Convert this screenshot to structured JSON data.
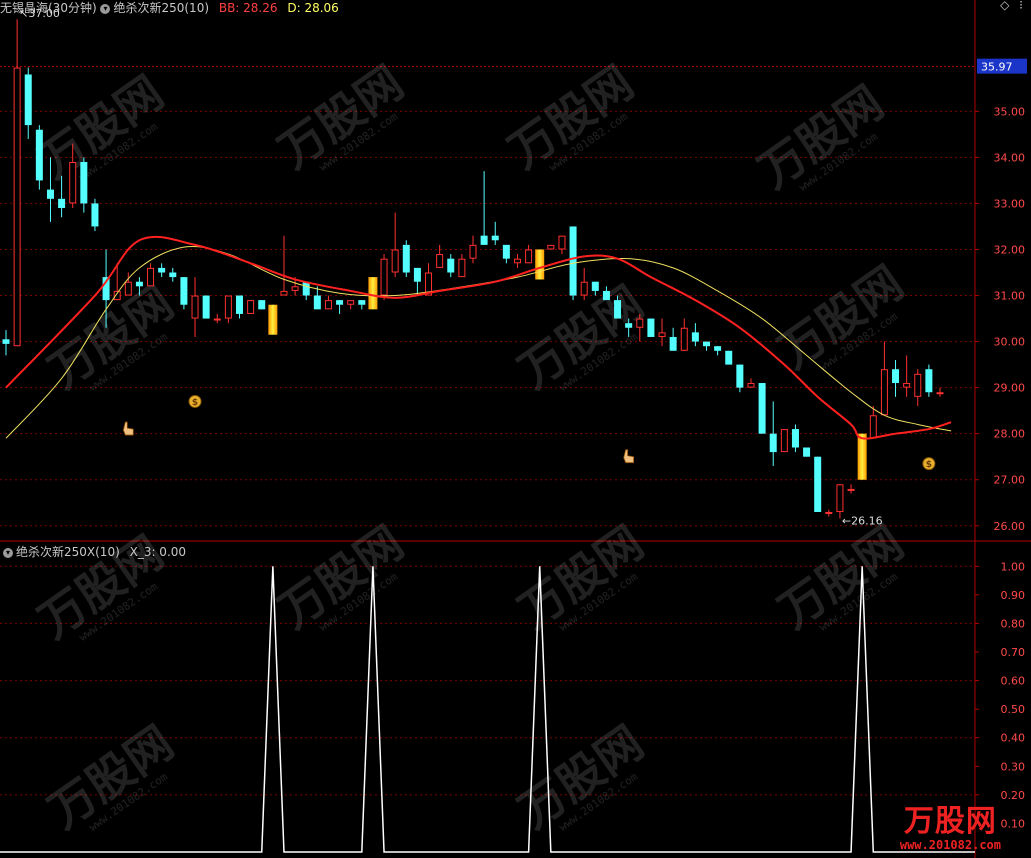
{
  "header": {
    "stock": "无锡晶海(30分钟)",
    "indicator": "绝杀次新250(10)",
    "bb_label": "BB: 28.26",
    "d_label": "D: 28.06"
  },
  "sub_header": {
    "indicator": "绝杀次新250X(10)",
    "value_label": "X_3: 0.00"
  },
  "top_right_icons": [
    "diamond-icon",
    "more-icon"
  ],
  "watermark": {
    "text": "万股网",
    "url": "www.201082.com"
  },
  "logo": {
    "text": "万股网",
    "url": "www.201082.com"
  },
  "colors": {
    "up": "#ff3030",
    "down": "#54ffff",
    "signal": "#ffcc00",
    "line_red": "#ff2020",
    "line_yellow": "#f0e060",
    "grid": "#7a0000"
  },
  "chart_data": [
    {
      "type": "candlestick",
      "ylim": [
        25.8,
        37.2
      ],
      "y_ticks": [
        26.0,
        27.0,
        28.0,
        29.0,
        30.0,
        31.0,
        32.0,
        33.0,
        34.0,
        35.0
      ],
      "current_price_label": "35.97",
      "max_label": "37.00",
      "min_label": "26.16",
      "candles": [
        {
          "o": 30.05,
          "h": 30.25,
          "l": 29.7,
          "c": 29.95
        },
        {
          "o": 29.9,
          "h": 37.0,
          "l": 29.9,
          "c": 35.95
        },
        {
          "o": 35.8,
          "h": 35.95,
          "l": 34.4,
          "c": 34.7
        },
        {
          "o": 34.6,
          "h": 34.7,
          "l": 33.3,
          "c": 33.5
        },
        {
          "o": 33.3,
          "h": 34.0,
          "l": 32.6,
          "c": 33.1
        },
        {
          "o": 33.1,
          "h": 33.6,
          "l": 32.7,
          "c": 32.9
        },
        {
          "o": 33.0,
          "h": 34.3,
          "l": 32.9,
          "c": 33.9
        },
        {
          "o": 33.9,
          "h": 34.0,
          "l": 32.8,
          "c": 33.0
        },
        {
          "o": 33.0,
          "h": 33.1,
          "l": 32.4,
          "c": 32.5
        },
        {
          "o": 31.4,
          "h": 32.0,
          "l": 30.3,
          "c": 30.9
        },
        {
          "o": 30.9,
          "h": 31.7,
          "l": 30.9,
          "c": 31.1
        },
        {
          "o": 31.0,
          "h": 31.5,
          "l": 31.0,
          "c": 31.3
        },
        {
          "o": 31.3,
          "h": 31.4,
          "l": 31.0,
          "c": 31.2
        },
        {
          "o": 31.2,
          "h": 31.7,
          "l": 31.2,
          "c": 31.6
        },
        {
          "o": 31.6,
          "h": 31.7,
          "l": 31.4,
          "c": 31.5
        },
        {
          "o": 31.5,
          "h": 31.6,
          "l": 31.3,
          "c": 31.4
        },
        {
          "o": 31.4,
          "h": 31.4,
          "l": 30.7,
          "c": 30.8
        },
        {
          "o": 30.5,
          "h": 31.4,
          "l": 30.1,
          "c": 31.0
        },
        {
          "o": 31.0,
          "h": 31.0,
          "l": 30.5,
          "c": 30.5
        },
        {
          "o": 30.5,
          "h": 30.6,
          "l": 30.4,
          "c": 30.5
        },
        {
          "o": 30.5,
          "h": 31.0,
          "l": 30.4,
          "c": 31.0
        },
        {
          "o": 31.0,
          "h": 31.0,
          "l": 30.5,
          "c": 30.6
        },
        {
          "o": 30.6,
          "h": 30.9,
          "l": 30.6,
          "c": 30.9
        },
        {
          "o": 30.9,
          "h": 30.9,
          "l": 30.7,
          "c": 30.7
        },
        {
          "o": 30.7,
          "h": 30.8,
          "l": 30.6,
          "c": 30.8
        },
        {
          "o": 31.0,
          "h": 32.3,
          "l": 31.0,
          "c": 31.1
        },
        {
          "o": 31.1,
          "h": 31.4,
          "l": 31.0,
          "c": 31.2
        },
        {
          "o": 31.3,
          "h": 31.3,
          "l": 30.9,
          "c": 31.0
        },
        {
          "o": 31.0,
          "h": 31.2,
          "l": 30.8,
          "c": 30.7
        },
        {
          "o": 30.7,
          "h": 31.0,
          "l": 30.7,
          "c": 30.9
        },
        {
          "o": 30.9,
          "h": 30.9,
          "l": 30.6,
          "c": 30.8
        },
        {
          "o": 30.8,
          "h": 30.9,
          "l": 30.7,
          "c": 30.9
        },
        {
          "o": 30.9,
          "h": 30.9,
          "l": 30.7,
          "c": 30.8
        },
        {
          "o": 30.7,
          "h": 31.4,
          "l": 30.7,
          "c": 31.4
        },
        {
          "o": 31.0,
          "h": 31.9,
          "l": 30.9,
          "c": 31.8
        },
        {
          "o": 31.5,
          "h": 32.8,
          "l": 31.4,
          "c": 32.0
        },
        {
          "o": 32.1,
          "h": 32.2,
          "l": 31.4,
          "c": 31.5
        },
        {
          "o": 31.6,
          "h": 31.6,
          "l": 31.0,
          "c": 31.3
        },
        {
          "o": 31.0,
          "h": 31.7,
          "l": 31.0,
          "c": 31.5
        },
        {
          "o": 31.6,
          "h": 32.1,
          "l": 31.6,
          "c": 31.9
        },
        {
          "o": 31.8,
          "h": 31.9,
          "l": 31.4,
          "c": 31.5
        },
        {
          "o": 31.4,
          "h": 31.9,
          "l": 31.4,
          "c": 31.8
        },
        {
          "o": 31.8,
          "h": 32.3,
          "l": 31.7,
          "c": 32.1
        },
        {
          "o": 32.3,
          "h": 33.7,
          "l": 32.1,
          "c": 32.1
        },
        {
          "o": 32.3,
          "h": 32.6,
          "l": 32.1,
          "c": 32.2
        },
        {
          "o": 32.1,
          "h": 32.1,
          "l": 31.7,
          "c": 31.8
        },
        {
          "o": 31.7,
          "h": 31.9,
          "l": 31.6,
          "c": 31.8
        },
        {
          "o": 31.7,
          "h": 32.1,
          "l": 31.7,
          "c": 32.0
        },
        {
          "o": 31.9,
          "h": 32.0,
          "l": 31.8,
          "c": 32.0
        },
        {
          "o": 32.0,
          "h": 32.1,
          "l": 32.0,
          "c": 32.1
        },
        {
          "o": 32.0,
          "h": 32.3,
          "l": 31.9,
          "c": 32.3
        },
        {
          "o": 32.5,
          "h": 32.5,
          "l": 30.9,
          "c": 31.0
        },
        {
          "o": 31.0,
          "h": 31.6,
          "l": 30.9,
          "c": 31.3
        },
        {
          "o": 31.3,
          "h": 31.3,
          "l": 31.0,
          "c": 31.1
        },
        {
          "o": 31.1,
          "h": 31.2,
          "l": 30.9,
          "c": 30.9
        },
        {
          "o": 30.9,
          "h": 31.0,
          "l": 30.5,
          "c": 30.5
        },
        {
          "o": 30.4,
          "h": 30.5,
          "l": 30.1,
          "c": 30.3
        },
        {
          "o": 30.3,
          "h": 30.6,
          "l": 30.0,
          "c": 30.5
        },
        {
          "o": 30.5,
          "h": 30.5,
          "l": 30.1,
          "c": 30.1
        },
        {
          "o": 30.1,
          "h": 30.5,
          "l": 29.9,
          "c": 30.2
        },
        {
          "o": 30.1,
          "h": 30.3,
          "l": 29.8,
          "c": 29.8
        },
        {
          "o": 29.8,
          "h": 30.5,
          "l": 29.8,
          "c": 30.3
        },
        {
          "o": 30.2,
          "h": 30.4,
          "l": 29.9,
          "c": 30.0
        },
        {
          "o": 30.0,
          "h": 30.0,
          "l": 29.8,
          "c": 29.9
        },
        {
          "o": 29.9,
          "h": 29.9,
          "l": 29.7,
          "c": 29.8
        },
        {
          "o": 29.8,
          "h": 29.8,
          "l": 29.5,
          "c": 29.5
        },
        {
          "o": 29.5,
          "h": 29.5,
          "l": 28.9,
          "c": 29.0
        },
        {
          "o": 29.0,
          "h": 29.2,
          "l": 29.0,
          "c": 29.1
        },
        {
          "o": 29.1,
          "h": 29.1,
          "l": 28.0,
          "c": 28.0
        },
        {
          "o": 28.0,
          "h": 28.7,
          "l": 27.3,
          "c": 27.6
        },
        {
          "o": 27.6,
          "h": 28.1,
          "l": 27.6,
          "c": 28.1
        },
        {
          "o": 28.1,
          "h": 28.2,
          "l": 27.6,
          "c": 27.7
        },
        {
          "o": 27.7,
          "h": 27.7,
          "l": 27.5,
          "c": 27.5
        },
        {
          "o": 27.5,
          "h": 27.5,
          "l": 26.3,
          "c": 26.3
        },
        {
          "o": 26.3,
          "h": 26.35,
          "l": 26.2,
          "c": 26.3
        },
        {
          "o": 26.3,
          "h": 26.9,
          "l": 26.16,
          "c": 26.9
        },
        {
          "o": 26.8,
          "h": 26.9,
          "l": 26.7,
          "c": 26.8
        },
        {
          "o": 27.0,
          "h": 28.0,
          "l": 27.0,
          "c": 28.0
        },
        {
          "o": 27.9,
          "h": 28.6,
          "l": 27.9,
          "c": 28.4
        },
        {
          "o": 28.4,
          "h": 30.0,
          "l": 28.4,
          "c": 29.4
        },
        {
          "o": 29.4,
          "h": 29.6,
          "l": 28.8,
          "c": 29.1
        },
        {
          "o": 29.0,
          "h": 29.7,
          "l": 28.8,
          "c": 29.1
        },
        {
          "o": 28.8,
          "h": 29.4,
          "l": 28.6,
          "c": 29.3
        },
        {
          "o": 29.4,
          "h": 29.5,
          "l": 28.8,
          "c": 28.9
        },
        {
          "o": 28.9,
          "h": 29.0,
          "l": 28.8,
          "c": 28.9
        }
      ],
      "signal_candles": [
        24,
        33,
        48,
        77
      ],
      "red_line": [
        [
          0,
          29.0
        ],
        [
          8,
          31.0
        ],
        [
          12,
          32.2
        ],
        [
          17,
          32.1
        ],
        [
          22,
          31.7
        ],
        [
          26,
          31.35
        ],
        [
          31,
          31.1
        ],
        [
          35,
          30.95
        ],
        [
          39,
          31.1
        ],
        [
          44,
          31.3
        ],
        [
          48,
          31.6
        ],
        [
          52,
          31.85
        ],
        [
          55,
          31.8
        ],
        [
          58,
          31.4
        ],
        [
          62,
          30.9
        ],
        [
          66,
          30.3
        ],
        [
          70,
          29.5
        ],
        [
          73,
          28.8
        ],
        [
          76,
          28.2
        ],
        [
          77,
          27.9
        ],
        [
          80,
          28.0
        ],
        [
          83,
          28.1
        ],
        [
          85,
          28.25
        ]
      ],
      "yellow_line": [
        [
          0,
          27.9
        ],
        [
          5,
          29.2
        ],
        [
          9,
          30.7
        ],
        [
          12,
          31.6
        ],
        [
          16,
          32.05
        ],
        [
          20,
          31.9
        ],
        [
          25,
          31.35
        ],
        [
          30,
          31.05
        ],
        [
          35,
          31.0
        ],
        [
          40,
          31.15
        ],
        [
          46,
          31.4
        ],
        [
          51,
          31.7
        ],
        [
          56,
          31.8
        ],
        [
          60,
          31.6
        ],
        [
          64,
          31.1
        ],
        [
          68,
          30.5
        ],
        [
          72,
          29.7
        ],
        [
          76,
          28.9
        ],
        [
          79,
          28.4
        ],
        [
          82,
          28.2
        ],
        [
          85,
          28.06
        ]
      ],
      "markers": [
        {
          "type": "money-bag",
          "index": 17,
          "y": 28.7
        },
        {
          "type": "hand-pointer",
          "index": 11,
          "y": 28.1
        },
        {
          "type": "hand-pointer",
          "index": 56,
          "y": 27.5
        },
        {
          "type": "money-bag",
          "index": 83,
          "y": 27.35
        }
      ]
    },
    {
      "type": "line",
      "ylim": [
        0,
        1.05
      ],
      "y_ticks": [
        0.1,
        0.2,
        0.3,
        0.4,
        0.5,
        0.6,
        0.7,
        0.8,
        0.9,
        1.0
      ],
      "y_tick_labels": [
        "0.10",
        "0.20",
        "0.30",
        "0.40",
        "0.50",
        "0.60",
        "0.70",
        "0.80",
        "0.90",
        "1.00"
      ],
      "series": [
        {
          "spikes_at": [
            24,
            33,
            48,
            77
          ],
          "peak": 1.0,
          "base": 0.0
        }
      ]
    }
  ]
}
